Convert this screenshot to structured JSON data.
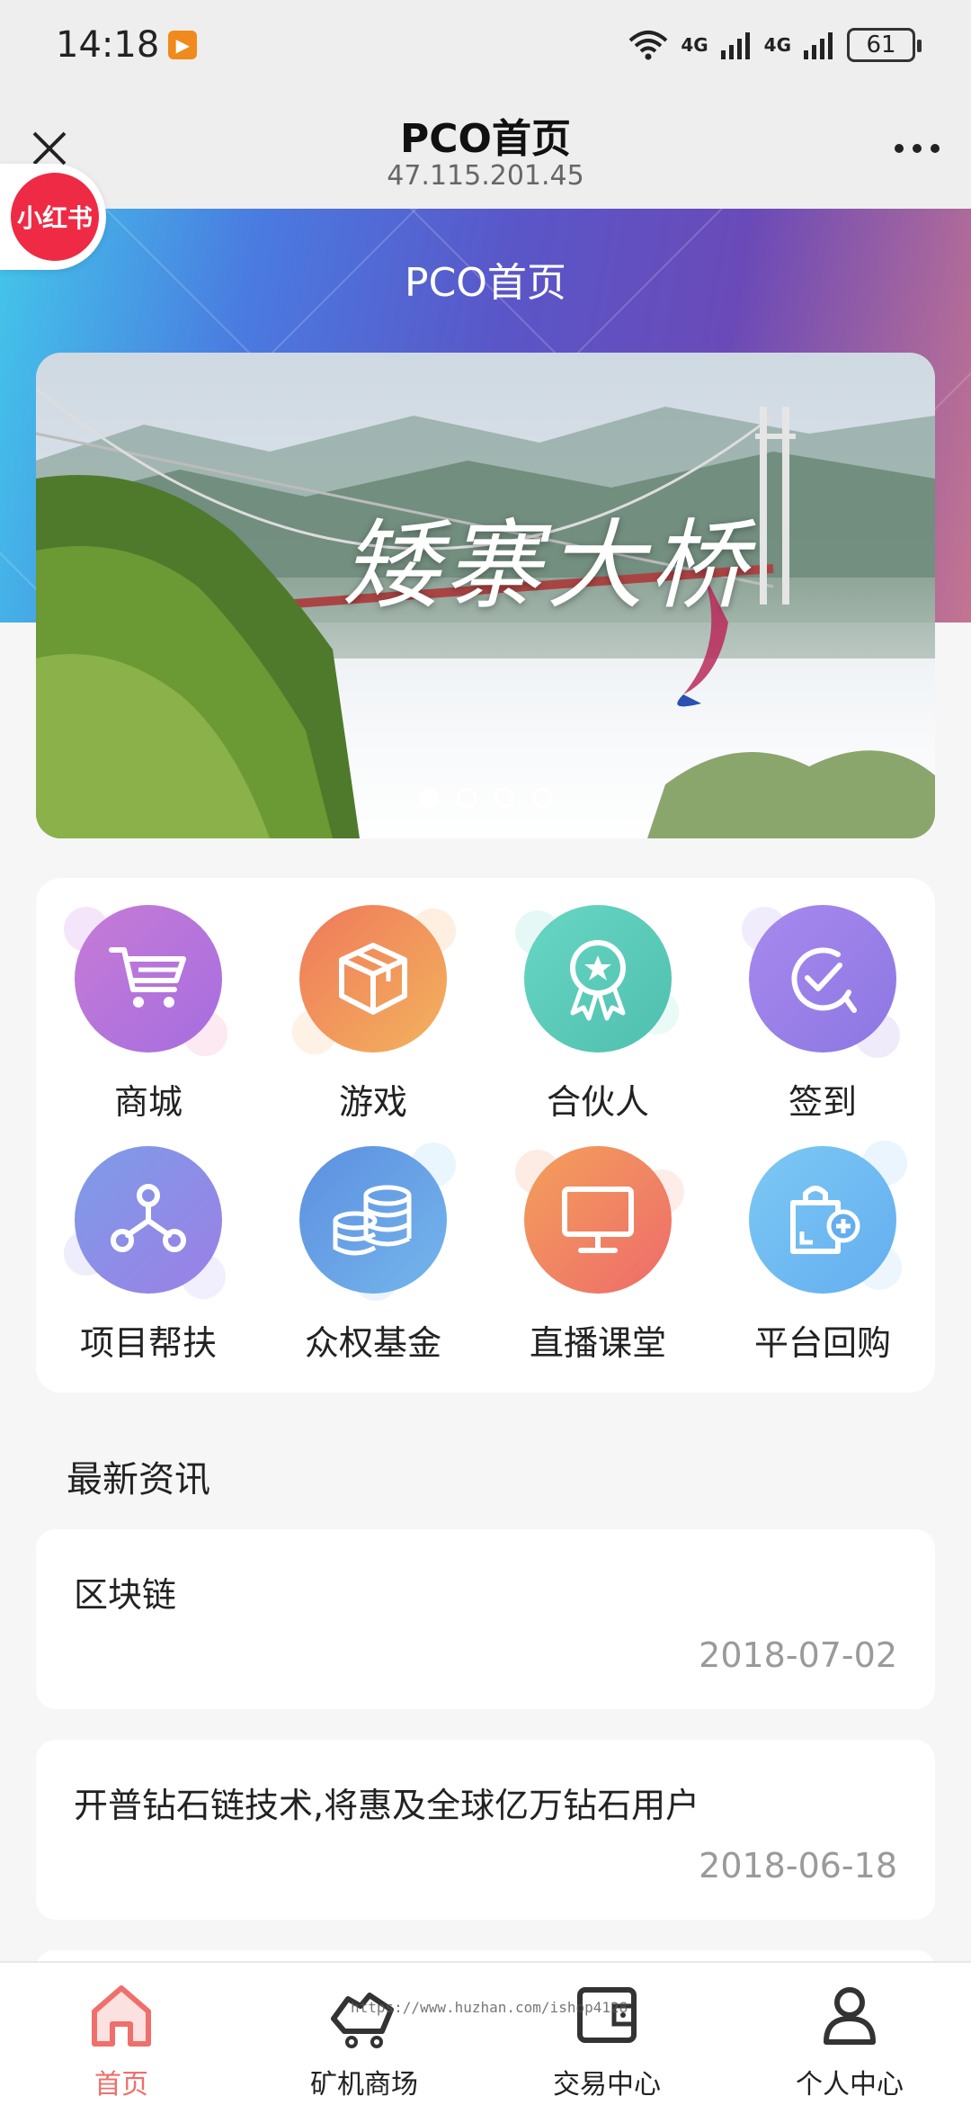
{
  "status": {
    "time": "14:18",
    "notification": "▶",
    "network1": "4G",
    "network2": "4G",
    "battery": "61"
  },
  "nav": {
    "title": "PCO首页",
    "subtitle": "47.115.201.45"
  },
  "hero": {
    "title": "PCO首页",
    "logo_text": "小红书"
  },
  "banner": {
    "caption": "矮寨大桥",
    "slides": 4,
    "active_slide": 0
  },
  "menu": [
    {
      "label": "商城",
      "icon": "cart-icon",
      "color": "#b96fd6"
    },
    {
      "label": "游戏",
      "icon": "box-icon",
      "color": "#f08a5d"
    },
    {
      "label": "合伙人",
      "icon": "award-icon",
      "color": "#5fcdbd"
    },
    {
      "label": "签到",
      "icon": "checkin-icon",
      "color": "#9a7fe6"
    },
    {
      "label": "项目帮扶",
      "icon": "network-icon",
      "color": "#8f86e8"
    },
    {
      "label": "众权基金",
      "icon": "coins-icon",
      "color": "#6f9ee6"
    },
    {
      "label": "直播课堂",
      "icon": "monitor-icon",
      "color": "#f07c5c"
    },
    {
      "label": "平台回购",
      "icon": "bag-icon",
      "color": "#6ab8ee"
    }
  ],
  "news": {
    "heading": "最新资讯",
    "items": [
      {
        "title": "区块链",
        "date": "2018-07-02"
      },
      {
        "title": "开普钻石链技术,将惠及全球亿万钻石用户",
        "date": "2018-06-18"
      }
    ]
  },
  "tabs": [
    {
      "label": "首页",
      "icon": "home-icon",
      "active": true
    },
    {
      "label": "矿机商场",
      "icon": "miner-cart-icon",
      "active": false
    },
    {
      "label": "交易中心",
      "icon": "wallet-icon",
      "active": false
    },
    {
      "label": "个人中心",
      "icon": "person-icon",
      "active": false
    }
  ],
  "watermark": "https://www.huzhan.com/ishop4128"
}
